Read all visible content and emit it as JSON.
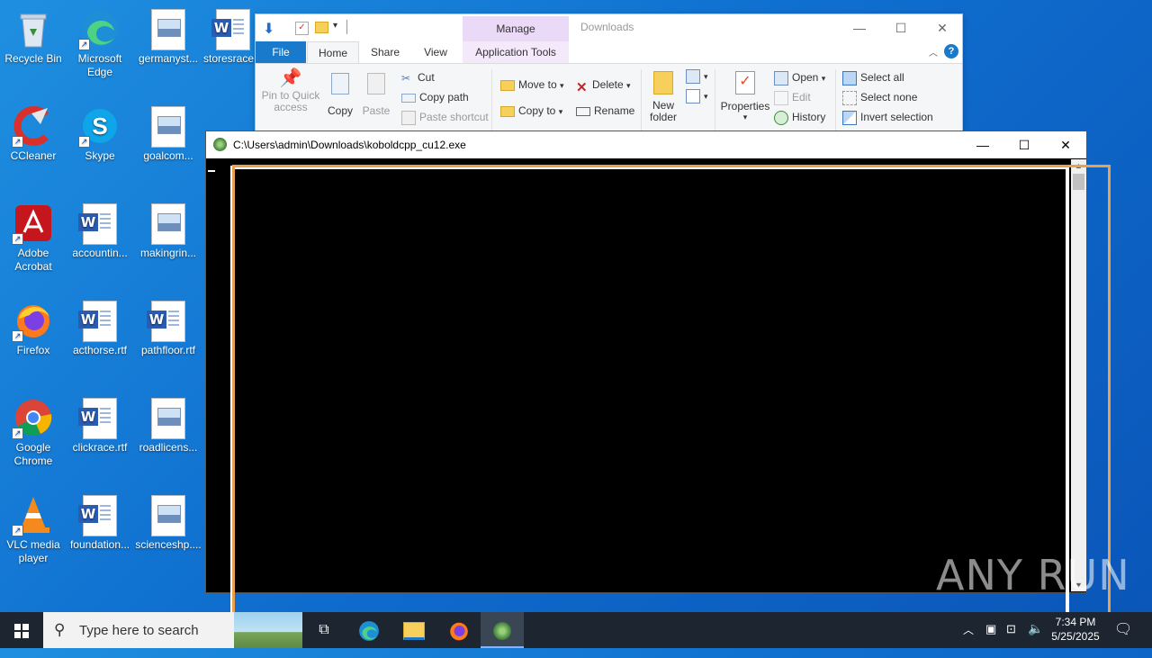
{
  "desktop": {
    "icons": [
      {
        "label": "Recycle Bin"
      },
      {
        "label": "Microsoft Edge"
      },
      {
        "label": "germanyst..."
      },
      {
        "label": "storesrace..."
      },
      {
        "label": "CCleaner"
      },
      {
        "label": "Skype"
      },
      {
        "label": "goalcom..."
      },
      {
        "label": "Adobe Acrobat"
      },
      {
        "label": "accountin..."
      },
      {
        "label": "makingrin..."
      },
      {
        "label": "Firefox"
      },
      {
        "label": "acthorse.rtf"
      },
      {
        "label": "pathfloor.rtf"
      },
      {
        "label": "Google Chrome"
      },
      {
        "label": "clickrace.rtf"
      },
      {
        "label": "roadlicens..."
      },
      {
        "label": "VLC media player"
      },
      {
        "label": "foundation..."
      },
      {
        "label": "scienceshp...."
      }
    ]
  },
  "explorer": {
    "title": "Downloads",
    "manage_tab": "Manage",
    "tabs": {
      "file": "File",
      "home": "Home",
      "share": "Share",
      "view": "View",
      "app_tools": "Application Tools"
    },
    "ribbon": {
      "pin_line1": "Pin to Quick",
      "pin_line2": "access",
      "copy": "Copy",
      "paste": "Paste",
      "cut": "Cut",
      "copy_path": "Copy path",
      "paste_shortcut": "Paste shortcut",
      "move_to": "Move to",
      "copy_to": "Copy to",
      "delete": "Delete",
      "rename": "Rename",
      "new_folder_line1": "New",
      "new_folder_line2": "folder",
      "properties": "Properties",
      "open": "Open",
      "edit": "Edit",
      "history": "History",
      "select_all": "Select all",
      "select_none": "Select none",
      "invert_selection": "Invert selection"
    }
  },
  "console": {
    "title": "C:\\Users\\admin\\Downloads\\koboldcpp_cu12.exe"
  },
  "watermark": "ANY RUN",
  "taskbar": {
    "search_placeholder": "Type here to search",
    "time": "7:34 PM",
    "date": "5/25/2025"
  }
}
